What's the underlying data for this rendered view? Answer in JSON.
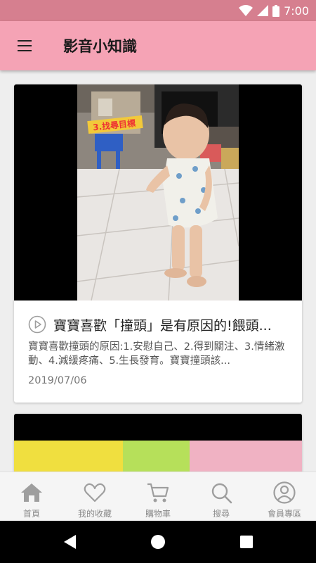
{
  "status_bar": {
    "time": "7:00"
  },
  "app_bar": {
    "title": "影音小知識"
  },
  "cards": [
    {
      "thumbnail_caption": "3.找尋目標",
      "title": "寶寶喜歡「撞頭」是有原因的!餵頭...",
      "description": "寶寶喜歡撞頭的原因:1.安慰自己、2.得到關注、3.情緒激動、4.減緩疼痛、5.生長發育。寶寶撞頭該...",
      "date": "2019/07/06"
    }
  ],
  "bottom_nav": [
    {
      "label": "首頁",
      "icon": "home-icon"
    },
    {
      "label": "我的收藏",
      "icon": "heart-icon"
    },
    {
      "label": "購物車",
      "icon": "cart-icon"
    },
    {
      "label": "搜尋",
      "icon": "search-icon"
    },
    {
      "label": "會員專區",
      "icon": "account-icon"
    }
  ],
  "colors": {
    "status_bar": "#d67f8f",
    "app_bar": "#f5a3b5",
    "nav_icon": "#9e9e9e"
  }
}
